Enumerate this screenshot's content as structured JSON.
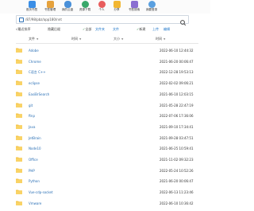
{
  "toolbar": {
    "items": [
      {
        "label": "首页书签",
        "icon": "bookmark-list-icon",
        "color": "#3a8ee6"
      },
      {
        "label": "书签管理",
        "icon": "bookmark-icon",
        "color": "#e6a23c"
      },
      {
        "label": "我的云盘",
        "icon": "cloud-icon",
        "color": "#4a90d9"
      },
      {
        "label": "资源下载",
        "icon": "download-icon",
        "color": "#3aa86b"
      },
      {
        "label": "个人",
        "icon": "user-icon",
        "color": "#e85d5d"
      },
      {
        "label": "分享",
        "icon": "share-icon",
        "color": "#f2b632"
      },
      {
        "label": "书签搜索",
        "icon": "search-icon",
        "color": "#8a6fd1"
      },
      {
        "label": "我要登录",
        "icon": "login-icon",
        "color": "#5aa0e0"
      }
    ]
  },
  "path": {
    "value": "/87/98/pbz/app180/nnt"
  },
  "filters": {
    "recent_label": "√最近排序",
    "hidden_label": "隐藏后缀",
    "all_label": "全部",
    "folder_label": "文件夹",
    "file_label": "文件",
    "new_label": "新建",
    "upload_label": "上传",
    "edit_label": "编辑"
  },
  "columns": {
    "name": "文件",
    "size_label": "时间",
    "size2_label": "大小",
    "date_label": "时间"
  },
  "rows": [
    {
      "name": "Adobe",
      "date": "2022-06-10 12:44:32"
    },
    {
      "name": "Chrome",
      "date": "2021-06-20 00:06:47"
    },
    {
      "name": "C语言 C++",
      "date": "2022-12-28 19:53:13"
    },
    {
      "name": "eclipse",
      "date": "2022-02-02 09:06:21"
    },
    {
      "name": "EasiBrSearch",
      "date": "2021-06-10 12:03:15"
    },
    {
      "name": "git",
      "date": "2021-05-28 22:47:19"
    },
    {
      "name": "ftnp",
      "date": "2022-07-06 17:36:06"
    },
    {
      "name": "Java",
      "date": "2021-09-10 17:34:41"
    },
    {
      "name": "JetBrain",
      "date": "2021-09-28 03:47:51"
    },
    {
      "name": "Node10",
      "date": "2021-06-25 10:59:41"
    },
    {
      "name": "Office",
      "date": "2021-11-02 09:32:23"
    },
    {
      "name": "PHP",
      "date": "2022-05-24 10:52:26"
    },
    {
      "name": "Python",
      "date": "2021-06-20 00:06:47"
    },
    {
      "name": "Vue-cdp-socket",
      "date": "2022-06-13 11:23:46"
    },
    {
      "name": "Vmware",
      "date": "2022-06-10 10:36:42"
    }
  ]
}
